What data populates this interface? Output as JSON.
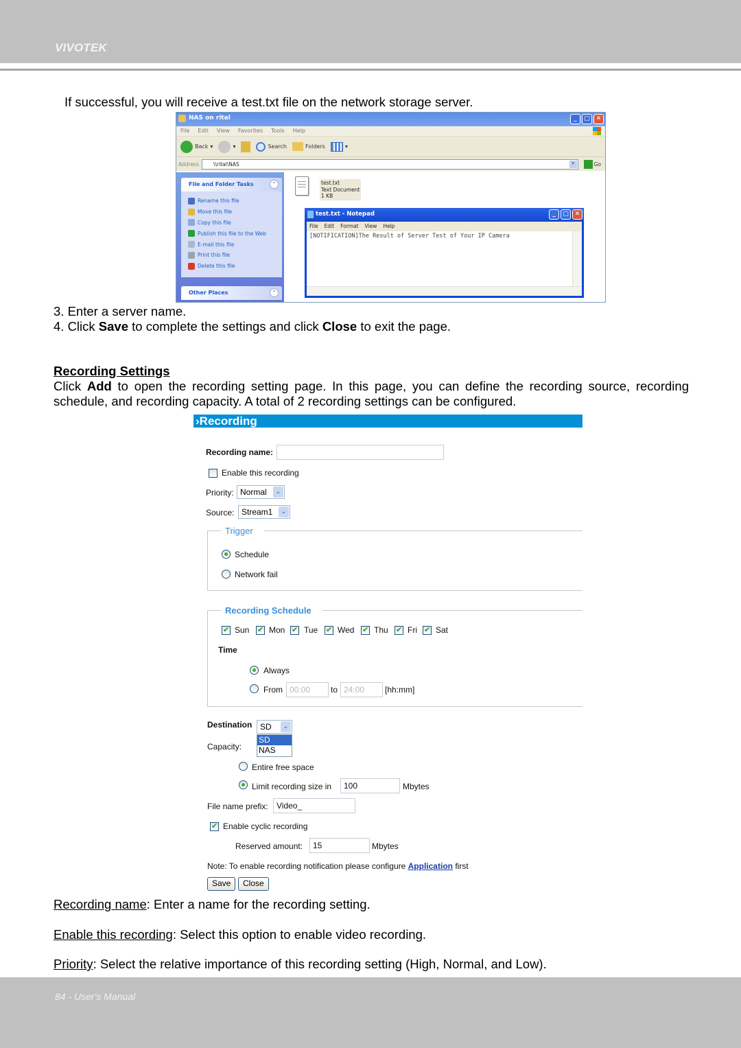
{
  "header": {
    "brand": "VIVOTEK"
  },
  "intro": "If successful, you will receive a test.txt file on the network storage server.",
  "explorer": {
    "title": "NAS on rital",
    "menu": [
      "File",
      "Edit",
      "View",
      "Favorites",
      "Tools",
      "Help"
    ],
    "toolbar": {
      "back": "Back",
      "search": "Search",
      "folders": "Folders"
    },
    "address_label": "Address",
    "address_value": "\\\\rital\\NAS",
    "go_label": "Go",
    "tasks_title": "File and Folder Tasks",
    "tasks": [
      {
        "label": "Rename this file",
        "icon": "rename-icon",
        "color": "#4a6fbf"
      },
      {
        "label": "Move this file",
        "icon": "move-icon",
        "color": "#e3b73a"
      },
      {
        "label": "Copy this file",
        "icon": "copy-icon",
        "color": "#8fa9d8"
      },
      {
        "label": "Publish this file to the Web",
        "icon": "globe-icon",
        "color": "#2e9b3e"
      },
      {
        "label": "E-mail this file",
        "icon": "email-icon",
        "color": "#a9b8d0"
      },
      {
        "label": "Print this file",
        "icon": "print-icon",
        "color": "#9aa4b0"
      },
      {
        "label": "Delete this file",
        "icon": "delete-icon",
        "color": "#d83a2a"
      }
    ],
    "other_places_title": "Other Places",
    "file": {
      "name": "test.txt",
      "type": "Text Document",
      "size": "1 KB"
    },
    "notepad": {
      "title": "test.txt - Notepad",
      "menu": [
        "File",
        "Edit",
        "Format",
        "View",
        "Help"
      ],
      "content": "[NOTIFICATION]The Result of Server Test of Your IP Camera"
    }
  },
  "steps": [
    {
      "prefix": "3. Enter a server name.",
      "bold1": "",
      "mid": "",
      "bold2": "",
      "suffix": ""
    },
    {
      "prefix": "4. Click ",
      "bold1": "Save",
      "mid": " to complete the settings and click ",
      "bold2": "Close",
      "suffix": " to exit the page."
    }
  ],
  "section": {
    "title": "Recording Settings",
    "para_a": "Click ",
    "para_bold": "Add",
    "para_b": " to open the recording setting page. In this page, you can define the recording source, recording schedule, and recording capacity. A total of 2 recording settings can be configured."
  },
  "form": {
    "title": "Recording",
    "recording_name_label": "Recording name:",
    "recording_name_value": "",
    "enable_label": "Enable this recording",
    "enable_checked": false,
    "priority_label": "Priority:",
    "priority_value": "Normal",
    "source_label": "Source:",
    "source_value": "Stream1",
    "trigger": {
      "title": "Trigger",
      "options": [
        {
          "label": "Schedule",
          "selected": true
        },
        {
          "label": "Network fail",
          "selected": false
        }
      ]
    },
    "schedule": {
      "title": "Recording Schedule",
      "days": [
        {
          "label": "Sun",
          "checked": true
        },
        {
          "label": "Mon",
          "checked": true
        },
        {
          "label": "Tue",
          "checked": true
        },
        {
          "label": "Wed",
          "checked": true
        },
        {
          "label": "Thu",
          "checked": true
        },
        {
          "label": "Fri",
          "checked": true
        },
        {
          "label": "Sat",
          "checked": true
        }
      ],
      "time_label": "Time",
      "always_label": "Always",
      "always_selected": true,
      "from_label": "From",
      "from_value": "00:00",
      "to_label": "to",
      "to_value": "24:00",
      "format_label": "[hh:mm]"
    },
    "destination_label": "Destination",
    "destination_value": "SD",
    "destination_options": [
      "SD",
      "NAS"
    ],
    "destination_highlighted": "SD",
    "capacity_label": "Capacity:",
    "capacity_entire_label": "Entire free space",
    "capacity_limit_label": "Limit recording size in",
    "capacity_limit_value": "100",
    "capacity_unit": "Mbytes",
    "capacity_selected": "limit",
    "prefix_label": "File name prefix:",
    "prefix_value": "Video_",
    "cyclic_label": "Enable cyclic recording",
    "cyclic_checked": true,
    "reserved_label": "Reserved amount:",
    "reserved_value": "15",
    "reserved_unit": "Mbytes",
    "note_prefix": "Note: To enable recording notification please configure ",
    "note_link": "Application",
    "note_suffix": " first",
    "save_label": "Save",
    "close_label": "Close"
  },
  "descriptions": [
    {
      "term": "Recording name",
      "text": ": Enter a name for the recording setting."
    },
    {
      "term": "Enable this recording",
      "text": ": Select this option to enable video recording."
    },
    {
      "term": "Priority",
      "text": ": Select the relative importance of this recording setting (High, Normal, and Low)."
    }
  ],
  "footer": {
    "text": "84 - User's Manual"
  }
}
